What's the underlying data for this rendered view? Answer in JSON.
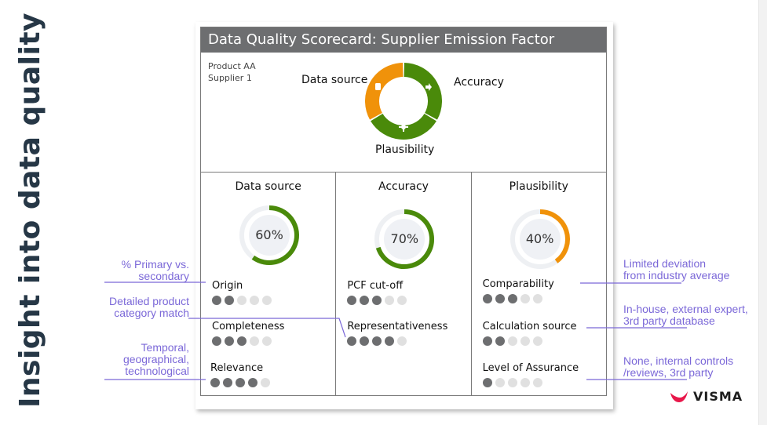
{
  "slide_title": "Insight into data quality",
  "scorecard": {
    "title": "Data Quality Scorecard: Supplier Emission Factor",
    "product": "Product AA",
    "supplier": "Supplier 1",
    "summary_segments": [
      {
        "label": "Data source",
        "icon": "database-icon",
        "color": "#4a8a0a"
      },
      {
        "label": "Accuracy",
        "icon": "arrow-right-icon",
        "color": "#4a8a0a"
      },
      {
        "label": "Plausibility",
        "icon": "crosshair-icon",
        "color": "#f0920a"
      }
    ],
    "columns": [
      {
        "title": "Data source",
        "score": 60,
        "score_label": "60%",
        "color": "#4a8a0a",
        "metrics": [
          {
            "label": "Origin",
            "rating": 2,
            "max": 5
          },
          {
            "label": "Completeness",
            "rating": 3,
            "max": 5
          },
          {
            "label": "Relevance",
            "rating": 4,
            "max": 5
          }
        ]
      },
      {
        "title": "Accuracy",
        "score": 70,
        "score_label": "70%",
        "color": "#4a8a0a",
        "metrics": [
          {
            "label": "PCF cut-off",
            "rating": 3,
            "max": 5
          },
          {
            "label": "Representativeness",
            "rating": 4,
            "max": 5
          }
        ]
      },
      {
        "title": "Plausibility",
        "score": 40,
        "score_label": "40%",
        "color": "#f0920a",
        "metrics": [
          {
            "label": "Comparability",
            "rating": 3,
            "max": 5
          },
          {
            "label": "Calculation source",
            "rating": 2,
            "max": 5
          },
          {
            "label": "Level of Assurance",
            "rating": 1,
            "max": 5
          }
        ]
      }
    ]
  },
  "annotations": {
    "left": [
      {
        "line1": "% Primary vs.",
        "line2": "secondary"
      },
      {
        "line1": "Detailed product",
        "line2": "category match"
      },
      {
        "line1": "Temporal,",
        "line2": "geographical,",
        "line3": "technological"
      }
    ],
    "right": [
      {
        "line1": "Limited deviation",
        "line2": "from industry average"
      },
      {
        "line1": "In-house, external expert,",
        "line2": "3rd party database"
      },
      {
        "line1": "None, internal controls",
        "line2": "/reviews, 3rd party"
      }
    ]
  },
  "brand": {
    "name": "VISMA",
    "color": "#e8174a"
  }
}
